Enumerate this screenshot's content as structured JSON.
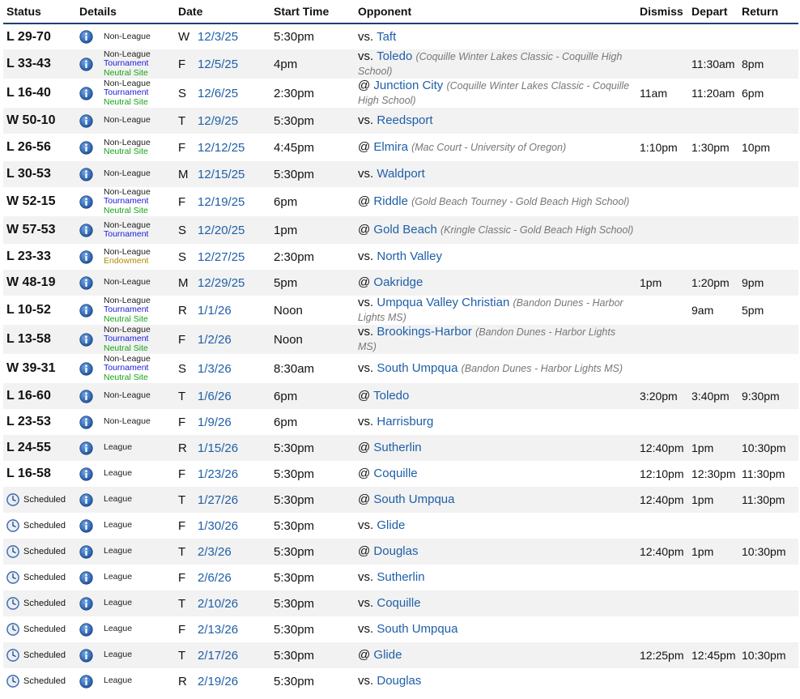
{
  "headers": {
    "status": "Status",
    "details": "Details",
    "date": "Date",
    "start_time": "Start Time",
    "opponent": "Opponent",
    "dismiss": "Dismiss",
    "depart": "Depart",
    "return": "Return"
  },
  "icons": {
    "info": "info-icon",
    "clock": "clock-icon"
  },
  "colors": {
    "link": "#1f5fa8",
    "tournament": "#1a1ad6",
    "neutral": "#15a315",
    "endowment": "#b38a00",
    "header_rule": "#1f3f73"
  },
  "games": [
    {
      "status": "L 29-70",
      "details": [
        "Non-League"
      ],
      "day": "W",
      "date": "12/3/25",
      "time": "5:30pm",
      "prefix": "vs.",
      "opponent": "Taft",
      "note": "",
      "dismiss": "",
      "depart": "",
      "return": ""
    },
    {
      "status": "L 33-43",
      "details": [
        "Non-League",
        "Tournament",
        "Neutral Site"
      ],
      "day": "F",
      "date": "12/5/25",
      "time": "4pm",
      "prefix": "vs.",
      "opponent": "Toledo",
      "note": "(Coquille Winter Lakes Classic - Coquille High School)",
      "dismiss": "",
      "depart": "11:30am",
      "return": "8pm"
    },
    {
      "status": "L 16-40",
      "details": [
        "Non-League",
        "Tournament",
        "Neutral Site"
      ],
      "day": "S",
      "date": "12/6/25",
      "time": "2:30pm",
      "prefix": "@",
      "opponent": "Junction City",
      "note": "(Coquille Winter Lakes Classic - Coquille High School)",
      "dismiss": "11am",
      "depart": "11:20am",
      "return": "6pm"
    },
    {
      "status": "W 50-10",
      "details": [
        "Non-League"
      ],
      "day": "T",
      "date": "12/9/25",
      "time": "5:30pm",
      "prefix": "vs.",
      "opponent": "Reedsport",
      "note": "",
      "dismiss": "",
      "depart": "",
      "return": ""
    },
    {
      "status": "L 26-56",
      "details": [
        "Non-League",
        "Neutral Site"
      ],
      "day": "F",
      "date": "12/12/25",
      "time": "4:45pm",
      "prefix": "@",
      "opponent": "Elmira",
      "note": "(Mac Court - University of Oregon)",
      "dismiss": "1:10pm",
      "depart": "1:30pm",
      "return": "10pm"
    },
    {
      "status": "L 30-53",
      "details": [
        "Non-League"
      ],
      "day": "M",
      "date": "12/15/25",
      "time": "5:30pm",
      "prefix": "vs.",
      "opponent": "Waldport",
      "note": "",
      "dismiss": "",
      "depart": "",
      "return": ""
    },
    {
      "status": "W 52-15",
      "details": [
        "Non-League",
        "Tournament",
        "Neutral Site"
      ],
      "day": "F",
      "date": "12/19/25",
      "time": "6pm",
      "prefix": "@",
      "opponent": "Riddle",
      "note": "(Gold Beach Tourney - Gold Beach High School)",
      "dismiss": "",
      "depart": "",
      "return": ""
    },
    {
      "status": "W 57-53",
      "details": [
        "Non-League",
        "Tournament"
      ],
      "day": "S",
      "date": "12/20/25",
      "time": "1pm",
      "prefix": "@",
      "opponent": "Gold Beach",
      "note": "(Kringle Classic - Gold Beach High School)",
      "dismiss": "",
      "depart": "",
      "return": ""
    },
    {
      "status": "L 23-33",
      "details": [
        "Non-League",
        "Endowment"
      ],
      "day": "S",
      "date": "12/27/25",
      "time": "2:30pm",
      "prefix": "vs.",
      "opponent": "North Valley",
      "note": "",
      "dismiss": "",
      "depart": "",
      "return": ""
    },
    {
      "status": "W 48-19",
      "details": [
        "Non-League"
      ],
      "day": "M",
      "date": "12/29/25",
      "time": "5pm",
      "prefix": "@",
      "opponent": "Oakridge",
      "note": "",
      "dismiss": "1pm",
      "depart": "1:20pm",
      "return": "9pm"
    },
    {
      "status": "L 10-52",
      "details": [
        "Non-League",
        "Tournament",
        "Neutral Site"
      ],
      "day": "R",
      "date": "1/1/26",
      "time": "Noon",
      "prefix": "vs.",
      "opponent": "Umpqua Valley Christian",
      "note": "(Bandon Dunes - Harbor Lights MS)",
      "dismiss": "",
      "depart": "9am",
      "return": "5pm"
    },
    {
      "status": "L 13-58",
      "details": [
        "Non-League",
        "Tournament",
        "Neutral Site"
      ],
      "day": "F",
      "date": "1/2/26",
      "time": "Noon",
      "prefix": "vs.",
      "opponent": "Brookings-Harbor",
      "note": "(Bandon Dunes - Harbor Lights MS)",
      "dismiss": "",
      "depart": "",
      "return": ""
    },
    {
      "status": "W 39-31",
      "details": [
        "Non-League",
        "Tournament",
        "Neutral Site"
      ],
      "day": "S",
      "date": "1/3/26",
      "time": "8:30am",
      "prefix": "vs.",
      "opponent": "South Umpqua",
      "note": "(Bandon Dunes - Harbor Lights MS)",
      "dismiss": "",
      "depart": "",
      "return": ""
    },
    {
      "status": "L 16-60",
      "details": [
        "Non-League"
      ],
      "day": "T",
      "date": "1/6/26",
      "time": "6pm",
      "prefix": "@",
      "opponent": "Toledo",
      "note": "",
      "dismiss": "3:20pm",
      "depart": "3:40pm",
      "return": "9:30pm"
    },
    {
      "status": "L 23-53",
      "details": [
        "Non-League"
      ],
      "day": "F",
      "date": "1/9/26",
      "time": "6pm",
      "prefix": "vs.",
      "opponent": "Harrisburg",
      "note": "",
      "dismiss": "",
      "depart": "",
      "return": ""
    },
    {
      "status": "L 24-55",
      "details": [
        "League"
      ],
      "day": "R",
      "date": "1/15/26",
      "time": "5:30pm",
      "prefix": "@",
      "opponent": "Sutherlin",
      "note": "",
      "dismiss": "12:40pm",
      "depart": "1pm",
      "return": "10:30pm"
    },
    {
      "status": "L 16-58",
      "details": [
        "League"
      ],
      "day": "F",
      "date": "1/23/26",
      "time": "5:30pm",
      "prefix": "@",
      "opponent": "Coquille",
      "note": "",
      "dismiss": "12:10pm",
      "depart": "12:30pm",
      "return": "11:30pm"
    },
    {
      "status": "Scheduled",
      "details": [
        "League"
      ],
      "day": "T",
      "date": "1/27/26",
      "time": "5:30pm",
      "prefix": "@",
      "opponent": "South Umpqua",
      "note": "",
      "dismiss": "12:40pm",
      "depart": "1pm",
      "return": "11:30pm"
    },
    {
      "status": "Scheduled",
      "details": [
        "League"
      ],
      "day": "F",
      "date": "1/30/26",
      "time": "5:30pm",
      "prefix": "vs.",
      "opponent": "Glide",
      "note": "",
      "dismiss": "",
      "depart": "",
      "return": ""
    },
    {
      "status": "Scheduled",
      "details": [
        "League"
      ],
      "day": "T",
      "date": "2/3/26",
      "time": "5:30pm",
      "prefix": "@",
      "opponent": "Douglas",
      "note": "",
      "dismiss": "12:40pm",
      "depart": "1pm",
      "return": "10:30pm"
    },
    {
      "status": "Scheduled",
      "details": [
        "League"
      ],
      "day": "F",
      "date": "2/6/26",
      "time": "5:30pm",
      "prefix": "vs.",
      "opponent": "Sutherlin",
      "note": "",
      "dismiss": "",
      "depart": "",
      "return": ""
    },
    {
      "status": "Scheduled",
      "details": [
        "League"
      ],
      "day": "T",
      "date": "2/10/26",
      "time": "5:30pm",
      "prefix": "vs.",
      "opponent": "Coquille",
      "note": "",
      "dismiss": "",
      "depart": "",
      "return": ""
    },
    {
      "status": "Scheduled",
      "details": [
        "League"
      ],
      "day": "F",
      "date": "2/13/26",
      "time": "5:30pm",
      "prefix": "vs.",
      "opponent": "South Umpqua",
      "note": "",
      "dismiss": "",
      "depart": "",
      "return": ""
    },
    {
      "status": "Scheduled",
      "details": [
        "League"
      ],
      "day": "T",
      "date": "2/17/26",
      "time": "5:30pm",
      "prefix": "@",
      "opponent": "Glide",
      "note": "",
      "dismiss": "12:25pm",
      "depart": "12:45pm",
      "return": "10:30pm"
    },
    {
      "status": "Scheduled",
      "details": [
        "League"
      ],
      "day": "R",
      "date": "2/19/26",
      "time": "5:30pm",
      "prefix": "vs.",
      "opponent": "Douglas",
      "note": "",
      "dismiss": "",
      "depart": "",
      "return": ""
    }
  ]
}
